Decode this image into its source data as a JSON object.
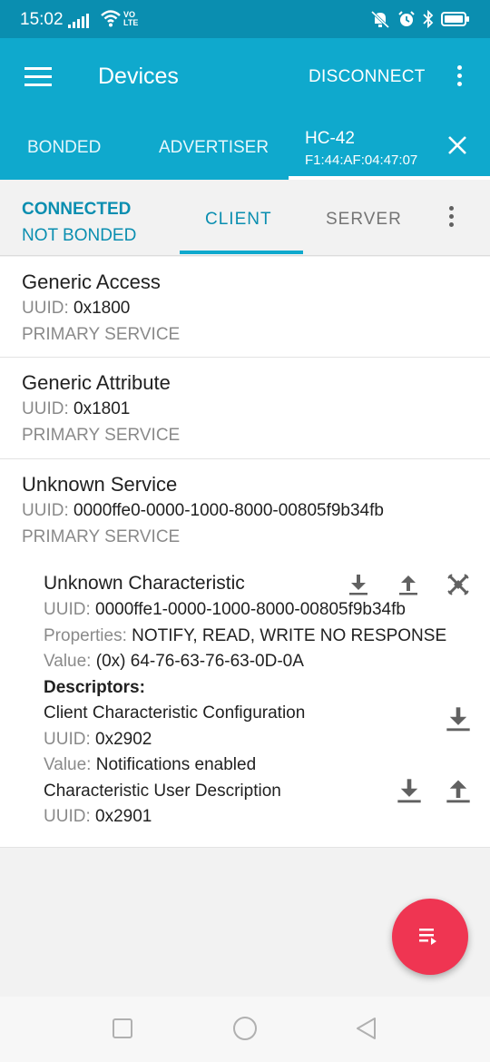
{
  "status_bar": {
    "time": "15:02",
    "network_label": "VO\nLTE",
    "icons": [
      "signal-icon",
      "wifi-icon",
      "mute-icon",
      "alarm-icon",
      "bluetooth-icon",
      "battery-icon"
    ]
  },
  "app_bar": {
    "title": "Devices",
    "disconnect_label": "DISCONNECT"
  },
  "device_tabs": {
    "bonded": "BONDED",
    "advertiser": "ADVERTISER",
    "device_name": "HC-42",
    "device_address": "F1:44:AF:04:47:07"
  },
  "connection": {
    "state": "CONNECTED",
    "bond_state": "NOT BONDED",
    "tabs": {
      "client": "CLIENT",
      "server": "SERVER"
    }
  },
  "services": [
    {
      "name": "Generic Access",
      "uuid_label": "UUID:",
      "uuid": "0x1800",
      "type": "PRIMARY SERVICE"
    },
    {
      "name": "Generic Attribute",
      "uuid_label": "UUID:",
      "uuid": "0x1801",
      "type": "PRIMARY SERVICE"
    },
    {
      "name": "Unknown Service",
      "uuid_label": "UUID:",
      "uuid": "0000ffe0-0000-1000-8000-00805f9b34fb",
      "type": "PRIMARY SERVICE"
    }
  ],
  "characteristic": {
    "name": "Unknown Characteristic",
    "uuid_label": "UUID:",
    "uuid": "0000ffe1-0000-1000-8000-00805f9b34fb",
    "properties_label": "Properties:",
    "properties": "NOTIFY, READ, WRITE NO RESPONSE",
    "value_label": "Value:",
    "value": "(0x) 64-76-63-76-63-0D-0A",
    "descriptors_heading": "Descriptors:",
    "descriptors": [
      {
        "name": "Client Characteristic Configuration",
        "uuid_label": "UUID:",
        "uuid": "0x2902",
        "value_label": "Value:",
        "value": "Notifications enabled"
      },
      {
        "name": "Characteristic User Description",
        "uuid_label": "UUID:",
        "uuid": "0x2901"
      }
    ]
  },
  "colors": {
    "status_bar": "#0a8eb0",
    "app_bar": "#0fa9cd",
    "accent": "#0a8eb0",
    "fab": "#ef3552"
  }
}
